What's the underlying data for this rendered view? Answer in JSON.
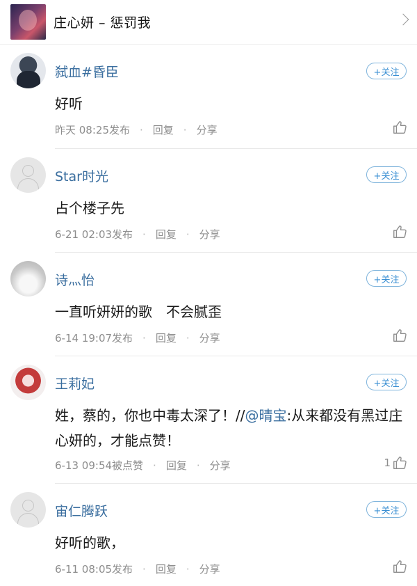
{
  "song": {
    "title": "庄心妍 – 惩罚我"
  },
  "comments": [
    {
      "username": "弑血#昏臣",
      "follow_label": "+关注",
      "text": "好听",
      "time": "昨天 08:25发布",
      "reply_label": "回复",
      "share_label": "分享",
      "likes": ""
    },
    {
      "username": "Star时光",
      "follow_label": "+关注",
      "text": "占个楼子先",
      "time": "6-21 02:03发布",
      "reply_label": "回复",
      "share_label": "分享",
      "likes": ""
    },
    {
      "username": "诗灬怡",
      "follow_label": "+关注",
      "text": "一直听妍妍的歌　不会腻歪",
      "time": "6-14 19:07发布",
      "reply_label": "回复",
      "share_label": "分享",
      "likes": ""
    },
    {
      "username": "王莉妃",
      "follow_label": "+关注",
      "text_before": "姓，蔡的，你也中毒太深了！//",
      "mention": "@晴宝",
      "text_after": ":从来都没有黑过庄心妍的，才能点赞！",
      "time": "6-13 09:54被点赞",
      "reply_label": "回复",
      "share_label": "分享",
      "likes": "1"
    },
    {
      "username": "宙仁腾跃",
      "follow_label": "+关注",
      "text": "好听的歌，",
      "time": "6-11 08:05发布",
      "reply_label": "回复",
      "share_label": "分享",
      "likes": ""
    }
  ]
}
